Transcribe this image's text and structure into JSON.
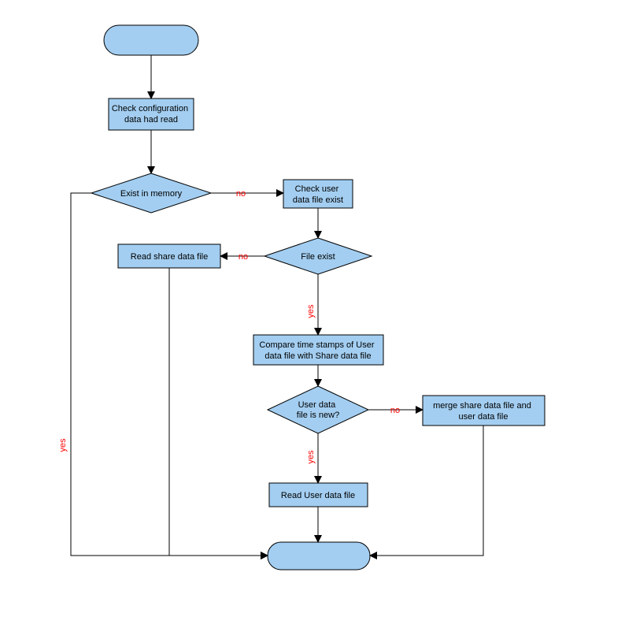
{
  "chart_data": {
    "type": "flowchart",
    "nodes": [
      {
        "id": "start",
        "kind": "terminal"
      },
      {
        "id": "check_config",
        "kind": "process",
        "text": "Check configuration\ndata had read"
      },
      {
        "id": "exist_mem",
        "kind": "decision",
        "text": "Exist in memory"
      },
      {
        "id": "check_user_file",
        "kind": "process",
        "text": "Check user\ndata file exist"
      },
      {
        "id": "file_exist",
        "kind": "decision",
        "text": "File exist"
      },
      {
        "id": "read_share",
        "kind": "process",
        "text": "Read share data file"
      },
      {
        "id": "compare",
        "kind": "process",
        "text": "Compare time stamps of User\ndata file with Share data file"
      },
      {
        "id": "user_new",
        "kind": "decision",
        "text": "User data\nfile is new?"
      },
      {
        "id": "merge",
        "kind": "process",
        "text": "merge share data file and\nuser data file"
      },
      {
        "id": "read_user",
        "kind": "process",
        "text": "Read User data file"
      },
      {
        "id": "end",
        "kind": "terminal"
      }
    ],
    "edges": [
      {
        "from": "start",
        "to": "check_config"
      },
      {
        "from": "check_config",
        "to": "exist_mem"
      },
      {
        "from": "exist_mem",
        "to": "end",
        "label": "yes"
      },
      {
        "from": "exist_mem",
        "to": "check_user_file",
        "label": "no"
      },
      {
        "from": "check_user_file",
        "to": "file_exist"
      },
      {
        "from": "file_exist",
        "to": "read_share",
        "label": "no"
      },
      {
        "from": "file_exist",
        "to": "compare",
        "label": "yes"
      },
      {
        "from": "read_share",
        "to": "end"
      },
      {
        "from": "compare",
        "to": "user_new"
      },
      {
        "from": "user_new",
        "to": "merge",
        "label": "no"
      },
      {
        "from": "user_new",
        "to": "read_user",
        "label": "yes"
      },
      {
        "from": "merge",
        "to": "end"
      },
      {
        "from": "read_user",
        "to": "end"
      }
    ]
  },
  "nodes": {
    "check_config": {
      "line1": "Check configuration",
      "line2": "data had read"
    },
    "exist_mem": {
      "label": "Exist in memory"
    },
    "check_user_file": {
      "line1": "Check user",
      "line2": "data file exist"
    },
    "file_exist": {
      "label": "File exist"
    },
    "read_share": {
      "label": "Read share data file"
    },
    "compare": {
      "line1": "Compare time stamps of User",
      "line2": "data file with Share data file"
    },
    "user_new": {
      "line1": "User data",
      "line2": "file is new?"
    },
    "merge": {
      "line1": "merge share data file and",
      "line2": "user data file"
    },
    "read_user": {
      "label": "Read User data file"
    }
  },
  "labels": {
    "yes": "yes",
    "no": "no"
  }
}
